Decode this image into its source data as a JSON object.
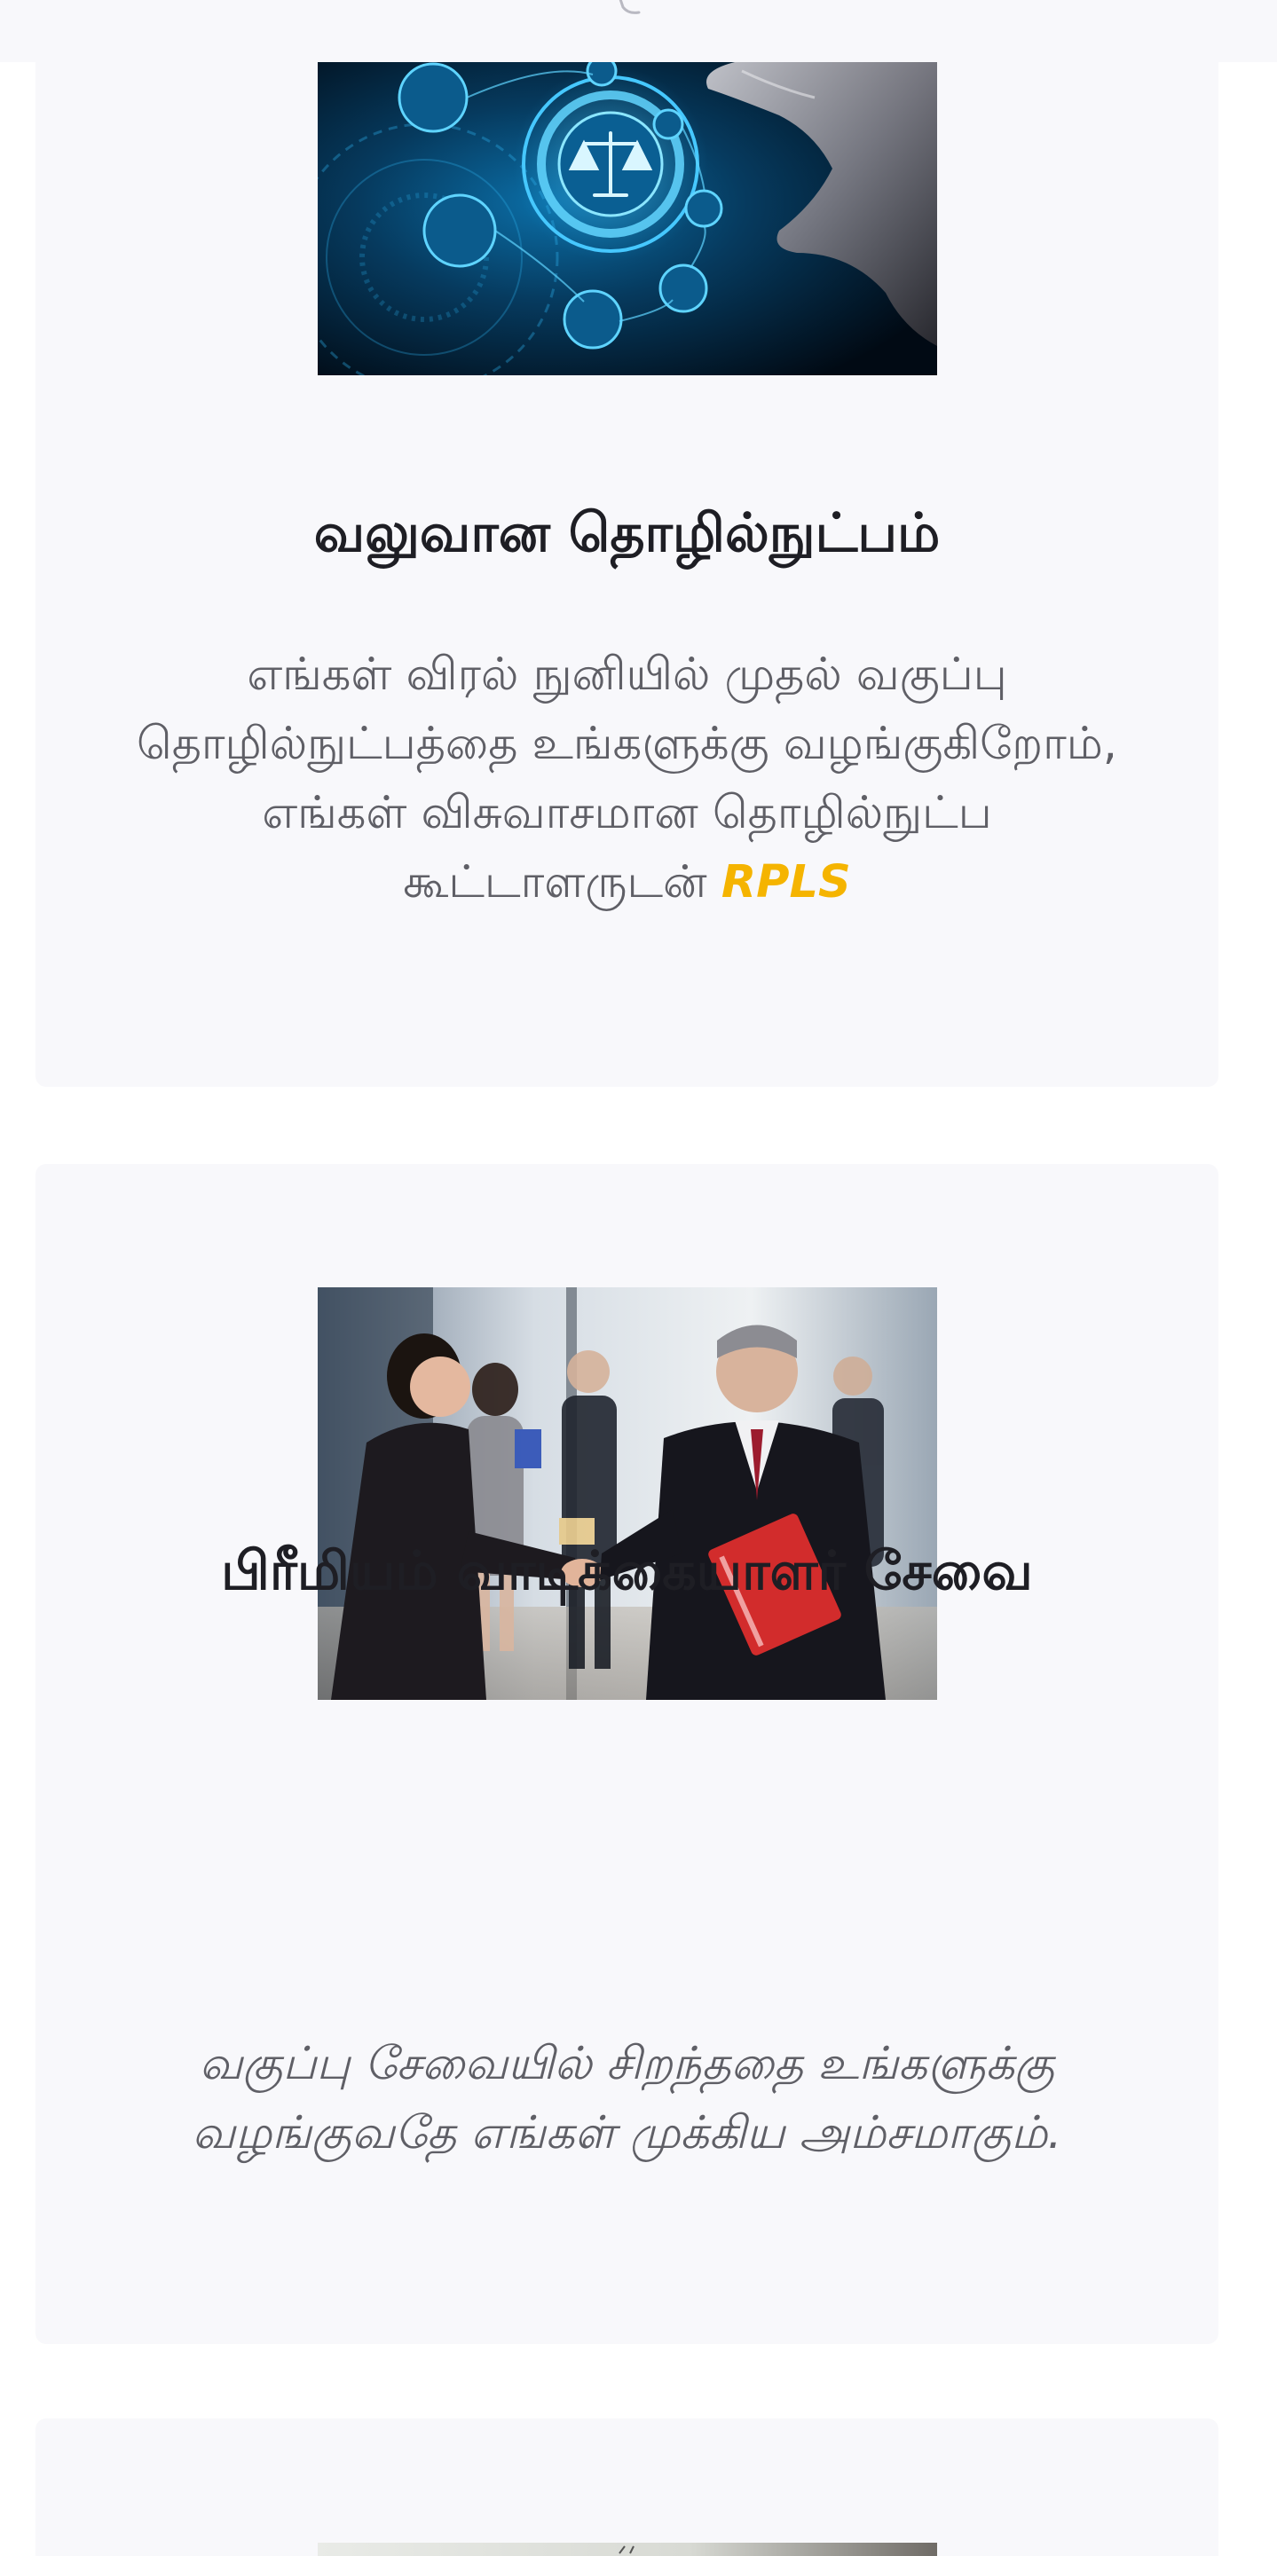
{
  "header": {
    "partial_icon": "scales-icon"
  },
  "cards": [
    {
      "image": "legal-technology-image",
      "title": "வலுவான தொழில்நுட்பம்",
      "description": "எங்கள் விரல் நுனியில் முதல் வகுப்பு தொழில்நுட்பத்தை உங்களுக்கு வழங்குகிறோம், எங்கள் விசுவாசமான தொழில்நுட்ப கூட்டாளருடன்",
      "brand": "RPLS"
    },
    {
      "image": "lawyer-handshake-image",
      "title": "பிரீமியம் வாடிக்கையாளர் சேவை",
      "description": "வகுப்பு சேவையில் சிறந்ததை உங்களுக்கு வழங்குவதே எங்கள் முக்கிய அம்சமாகும்."
    },
    {
      "image": "next-card-image"
    }
  ],
  "colors": {
    "card_background": "#f8f8fb",
    "title": "#1e1e24",
    "body_text": "#5f5f66",
    "brand_accent": "#f5b400"
  }
}
